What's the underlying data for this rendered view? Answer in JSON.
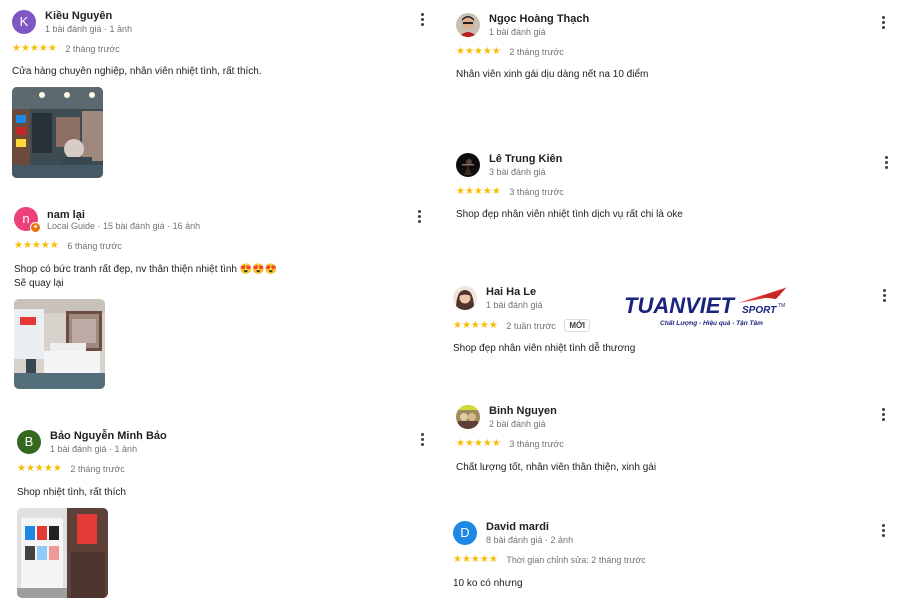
{
  "reviews_left": [
    {
      "initial": "K",
      "avatar_color": "#7e57c2",
      "name": "Kiều Nguyên",
      "meta": "1 bài đánh giá · 1 ảnh",
      "stars": "★★★★★",
      "date": "2 tháng trước",
      "text": "Cửa hàng chuyên nghiệp, nhân viên nhiệt tình, rất thích."
    },
    {
      "initial": "n",
      "avatar_color": "#ec407a",
      "name": "nam lại",
      "meta": "Local Guide · 15 bài đánh giá · 16 ảnh",
      "stars": "★★★★★",
      "date": "6 tháng trước",
      "text_line1": "Shop có bức tranh rất đẹp, nv thân thiện nhiệt tình 😍😍😍",
      "text_line2": "Sẽ quay lại"
    },
    {
      "initial": "B",
      "avatar_color": "#33691e",
      "name": "Bảo Nguyễn Minh Bảo",
      "meta": "1 bài đánh giá · 1 ảnh",
      "stars": "★★★★★",
      "date": "2 tháng trước",
      "text": "Shop nhiệt tình, rất thích"
    }
  ],
  "reviews_right": [
    {
      "avatar_icon": "person-photo",
      "name": "Ngọc Hoàng Thạch",
      "meta": "1 bài đánh giá",
      "stars": "★★★★★",
      "date": "2 tháng trước",
      "text": "Nhân viên xinh gái dịu dàng nết na 10 điểm"
    },
    {
      "avatar_icon": "dark-photo",
      "name": "Lê Trung Kiên",
      "meta": "3 bài đánh giá",
      "stars": "★★★★★",
      "date": "3 tháng trước",
      "text": "Shop đẹp nhân viên nhiệt tình dịch vụ rất chi là oke"
    },
    {
      "avatar_icon": "person-photo",
      "name": "Hai Ha Le",
      "meta": "1 bài đánh giá",
      "stars": "★★★★★",
      "date": "2 tuần trước",
      "badge": "MỚI",
      "text": "Shop đẹp nhân viên nhiệt tình dễ thương"
    },
    {
      "avatar_icon": "group-photo",
      "name": "Binh Nguyen",
      "meta": "2 bài đánh giá",
      "stars": "★★★★★",
      "date": "3 tháng trước",
      "text": "Chất lượng tốt, nhân viên thân thiện, xinh gái"
    },
    {
      "initial": "D",
      "avatar_color": "#1e88e5",
      "name": "David mardi",
      "meta": "8 bài đánh giá · 2 ảnh",
      "stars": "★★★★★",
      "date": "Thời gian chỉnh sửa: 2 tháng trước",
      "text": "10 ko có nhưng"
    }
  ],
  "logo": {
    "brand": "TUANVIET",
    "sub": "SPORT",
    "tm": "TM",
    "tagline": "Chất Lượng - Hiệu quả - Tận Tâm",
    "brand_color": "#1a237e",
    "accent_color": "#e53935"
  },
  "icons": {
    "more": "more-vert-icon",
    "local_guide": "local-guide-badge-icon",
    "star": "star-icon"
  }
}
